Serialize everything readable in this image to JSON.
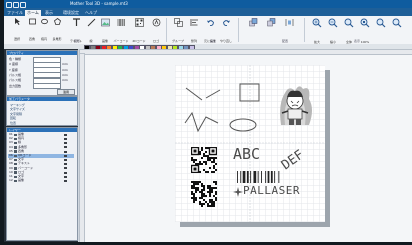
{
  "window": {
    "title": "Mother Tool 3D - sample.mt3"
  },
  "menu": [
    "ファイル",
    "ホーム",
    "表示",
    "環境設定",
    "ヘルプ"
  ],
  "ribbon": {
    "tools": [
      "選択",
      "四角",
      "楕円",
      "多角形",
      "テキスト",
      "線",
      "画像",
      "バーコード",
      "2Dコード",
      "ロゴ",
      "グループ",
      "整列",
      "元に戻す",
      "やり直し",
      "拡大",
      "縮小",
      "全体",
      "100%"
    ],
    "groups": [
      "図形",
      "編集",
      "配置",
      "表示"
    ]
  },
  "palette": [
    "#000000",
    "#7f7f7f",
    "#880015",
    "#ed1c24",
    "#ff7f27",
    "#fff200",
    "#22b14c",
    "#00a2e8",
    "#3f48cc",
    "#a349a4",
    "#ffffff",
    "#c3c3c3",
    "#b97a57",
    "#ffaec9",
    "#ffc90e",
    "#efe4b0",
    "#b5e61d",
    "#99d9ea",
    "#7092be",
    "#c8bfe7"
  ],
  "property_panel": {
    "title": "プロパティ",
    "rows": [
      {
        "label": "色・種類",
        "value": "",
        "unit": ""
      },
      {
        "label": "X 座標",
        "value": "",
        "unit": "mm"
      },
      {
        "label": "Y 座標",
        "value": "",
        "unit": "mm"
      },
      {
        "label": "パルス幅",
        "value": "",
        "unit": "mm"
      },
      {
        "label": "パルス幅",
        "value": "",
        "unit": "mm"
      },
      {
        "label": "出力回数",
        "value": "",
        "unit": ""
      }
    ],
    "apply": "適用"
  },
  "settings_panel": {
    "title": "加工パラメータ",
    "rows": [
      "マーキング",
      "文字サイズ",
      "文字間隔",
      "回転",
      "位置"
    ]
  },
  "layers_panel": {
    "title": "レイヤー",
    "rows": [
      {
        "n": "01",
        "name": "画像"
      },
      {
        "n": "02",
        "name": "楕円"
      },
      {
        "n": "03",
        "name": "線"
      },
      {
        "n": "04",
        "name": "多角形"
      },
      {
        "n": "05",
        "name": "四角"
      },
      {
        "n": "06",
        "name": "QRコード"
      },
      {
        "n": "07",
        "name": "文字"
      },
      {
        "n": "08",
        "name": "テキスト"
      },
      {
        "n": "09",
        "name": "バーコード"
      },
      {
        "n": "10",
        "name": "ロゴ"
      },
      {
        "n": "11",
        "name": "文字"
      },
      {
        "n": "12",
        "name": "画像"
      }
    ]
  },
  "canvas": {
    "text_abc": "ABC",
    "text_def": "DEF",
    "logo_text": "PALLASER"
  }
}
